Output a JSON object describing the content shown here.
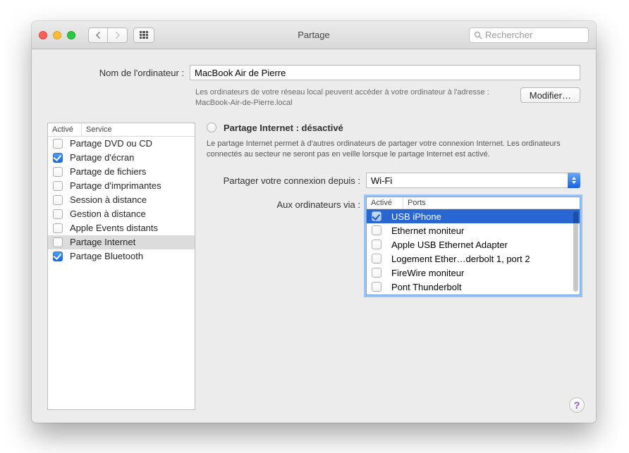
{
  "window": {
    "title": "Partage",
    "search_placeholder": "Rechercher"
  },
  "computer_name": {
    "label": "Nom de l'ordinateur :",
    "value": "MacBook Air de Pierre",
    "help_line1": "Les ordinateurs de votre réseau local peuvent accéder à votre ordinateur à l'adresse :",
    "help_line2": "MacBook-Air-de-Pierre.local",
    "modify_button": "Modifier…"
  },
  "services": {
    "header_active": "Activé",
    "header_service": "Service",
    "items": [
      {
        "checked": false,
        "label": "Partage DVD ou CD"
      },
      {
        "checked": true,
        "label": "Partage d'écran"
      },
      {
        "checked": false,
        "label": "Partage de fichiers"
      },
      {
        "checked": false,
        "label": "Partage d'imprimantes"
      },
      {
        "checked": false,
        "label": "Session à distance"
      },
      {
        "checked": false,
        "label": "Gestion à distance"
      },
      {
        "checked": false,
        "label": "Apple Events distants"
      },
      {
        "checked": false,
        "label": "Partage Internet",
        "selected": true
      },
      {
        "checked": true,
        "label": "Partage Bluetooth"
      }
    ]
  },
  "right": {
    "status_title": "Partage Internet : désactivé",
    "description": "Le partage Internet permet à d'autres ordinateurs de partager votre connexion Internet. Les ordinateurs connectés au secteur ne seront pas en veille lorsque le partage Internet est activé.",
    "share_from_label": "Partager votre connexion depuis :",
    "share_from_value": "Wi-Fi",
    "to_label": "Aux ordinateurs via :",
    "ports": {
      "header_active": "Activé",
      "header_ports": "Ports",
      "items": [
        {
          "checked": true,
          "label": "USB iPhone",
          "selected": true
        },
        {
          "checked": false,
          "label": "Ethernet moniteur"
        },
        {
          "checked": false,
          "label": "Apple USB Ethernet Adapter"
        },
        {
          "checked": false,
          "label": "Logement Ether…derbolt 1, port 2"
        },
        {
          "checked": false,
          "label": "FireWire moniteur"
        },
        {
          "checked": false,
          "label": "Pont Thunderbolt"
        }
      ]
    }
  },
  "help_glyph": "?"
}
